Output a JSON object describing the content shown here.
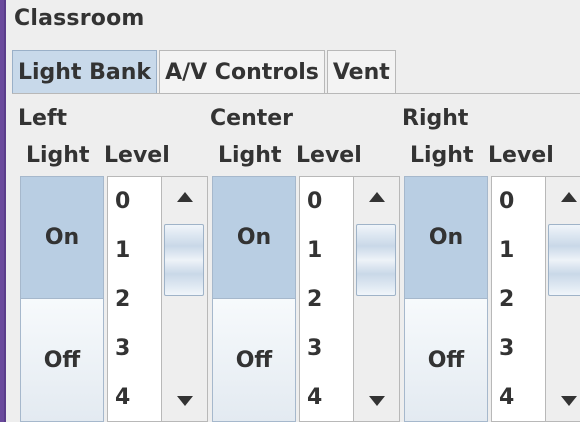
{
  "window": {
    "title": "Classroom"
  },
  "tabs": [
    {
      "label": "Light Bank",
      "active": true
    },
    {
      "label": "A/V Controls",
      "active": false
    },
    {
      "label": "Vent",
      "active": false
    }
  ],
  "banks": [
    {
      "title": "Left",
      "light_label": "Light",
      "level_label": "Level",
      "on_label": "On",
      "off_label": "Off",
      "state": "On",
      "levels": [
        "0",
        "1",
        "2",
        "3",
        "4"
      ]
    },
    {
      "title": "Center",
      "light_label": "Light",
      "level_label": "Level",
      "on_label": "On",
      "off_label": "Off",
      "state": "On",
      "levels": [
        "0",
        "1",
        "2",
        "3",
        "4"
      ]
    },
    {
      "title": "Right",
      "light_label": "Light",
      "level_label": "Level",
      "on_label": "On",
      "off_label": "Off",
      "state": "On",
      "levels": [
        "0",
        "1",
        "2",
        "3",
        "4"
      ]
    }
  ],
  "icons": {
    "scroll_up": "triangle-up-icon",
    "scroll_down": "triangle-down-icon"
  },
  "colors": {
    "selected_tab": "#c8d9ea",
    "on_button": "#b9cee3",
    "background": "#eeeeee",
    "frame": "#6a4a9c"
  }
}
